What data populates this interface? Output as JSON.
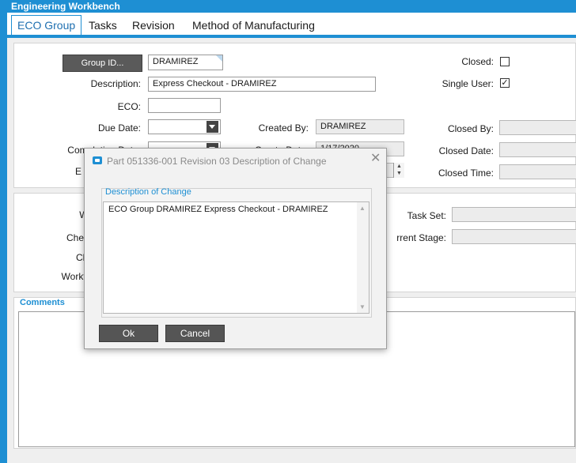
{
  "window": {
    "title": "Engineering Workbench"
  },
  "tabs": [
    {
      "label": "ECO Group",
      "active": true
    },
    {
      "label": "Tasks"
    },
    {
      "label": "Revision"
    },
    {
      "label": "Method of Manufacturing"
    }
  ],
  "form": {
    "group_id_button": "Group ID...",
    "group_id_value": "DRAMIREZ",
    "description_label": "Description:",
    "description_value": "Express Checkout - DRAMIREZ",
    "eco_label": "ECO:",
    "eco_value": "",
    "due_date_label": "Due Date:",
    "due_date_value": "",
    "completion_date_label": "Completion Date:",
    "completion_partial": "Com",
    "created_by_label": "Created By:",
    "created_by_value": "DRAMIREZ",
    "create_date_label": "Create Date:",
    "create_date_value": "1/17/2020",
    "e_partial": "E",
    "closed_label": "Closed:",
    "closed_checked": false,
    "single_user_label": "Single User:",
    "single_user_checked": true,
    "closed_by_label": "Closed By:",
    "closed_by_value": "",
    "closed_date_label": "Closed Date:",
    "closed_date_value": "",
    "closed_time_label": "Closed Time:",
    "closed_time_value": ""
  },
  "workflow": {
    "wo_partial": "Wo",
    "check1_partial": "Check",
    "check2_partial": "Che",
    "workflow_partial": "Workflo",
    "task_set_label": "Task Set:",
    "task_set_value": "",
    "current_stage_label": "rrent Stage:",
    "current_stage_value": ""
  },
  "comments": {
    "title": "Comments",
    "value": ""
  },
  "dialog": {
    "title": "Part 051336-001 Revision 03 Description of Change",
    "group_title": "Description of Change",
    "text": "ECO Group DRAMIREZ Express Checkout - DRAMIREZ",
    "ok_label": "Ok",
    "cancel_label": "Cancel",
    "close_glyph": "✕"
  },
  "colors": {
    "accent": "#1e8fd3",
    "button_dark": "#5a5a5a"
  }
}
